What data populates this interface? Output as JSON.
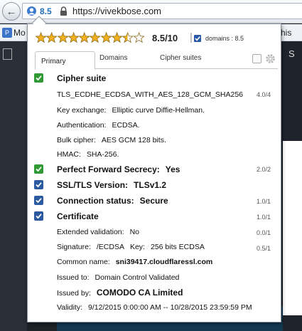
{
  "browser": {
    "score_label": "8.5",
    "url": "https://vivekbose.com",
    "bookmark_label": "Mo",
    "bookmark_right_label": "his",
    "page_right_label": "S"
  },
  "panel": {
    "stars_filled": 8.5,
    "stars_total": 10,
    "score": "8.5/10",
    "domains_label": "domains : 8.5",
    "tabs": [
      {
        "label": "Primary",
        "active": true
      },
      {
        "label": "Domains",
        "active": false
      },
      {
        "label": "Cipher suites",
        "active": false
      }
    ],
    "sections": {
      "cipher": {
        "title": "Cipher suite",
        "suite": "TLS_ECDHE_ECDSA_WITH_AES_128_GCM_SHA256",
        "fraction": "4.0/4",
        "key_exchange_label": "Key exchange:",
        "key_exchange_value": "Elliptic curve Diffie-Hellman.",
        "auth_label": "Authentication:",
        "auth_value": "ECDSA.",
        "bulk_label": "Bulk cipher:",
        "bulk_value": "AES GCM 128 bits.",
        "hmac_label": "HMAC:",
        "hmac_value": "SHA-256."
      },
      "pfs": {
        "title": "Perfect Forward Secrecy:",
        "value": "Yes",
        "fraction": "2.0/2"
      },
      "tls": {
        "title": "SSL/TLS Version:",
        "value": "TLSv1.2"
      },
      "conn": {
        "title": "Connection status:",
        "value": "Secure",
        "fraction": "1.0/1"
      },
      "cert": {
        "title": "Certificate",
        "fraction": "1.0/1",
        "ev_label": "Extended validation:",
        "ev_value": "No",
        "ev_fraction": "0.0/1",
        "sig_label": "Signature:",
        "sig_value": "/ECDSA",
        "key_label": "Key:",
        "key_value": "256 bits ECDSA",
        "key_fraction": "0.5/1",
        "cn_label": "Common name:",
        "cn_value": "sni39417.cloudflaressl.com",
        "issued_to_label": "Issued to:",
        "issued_to_value": "Domain Control Validated",
        "issued_by_label": "Issued by:",
        "issued_by_value": "COMODO CA Limited",
        "validity_label": "Validity:",
        "validity_value": "9/12/2015 0:00:00 AM -- 10/28/2015 23:59:59 PM"
      }
    }
  },
  "colors": {
    "check_green": "#2f9a34",
    "check_blue": "#2c5aa0",
    "star_gold": "#f2b01e"
  }
}
